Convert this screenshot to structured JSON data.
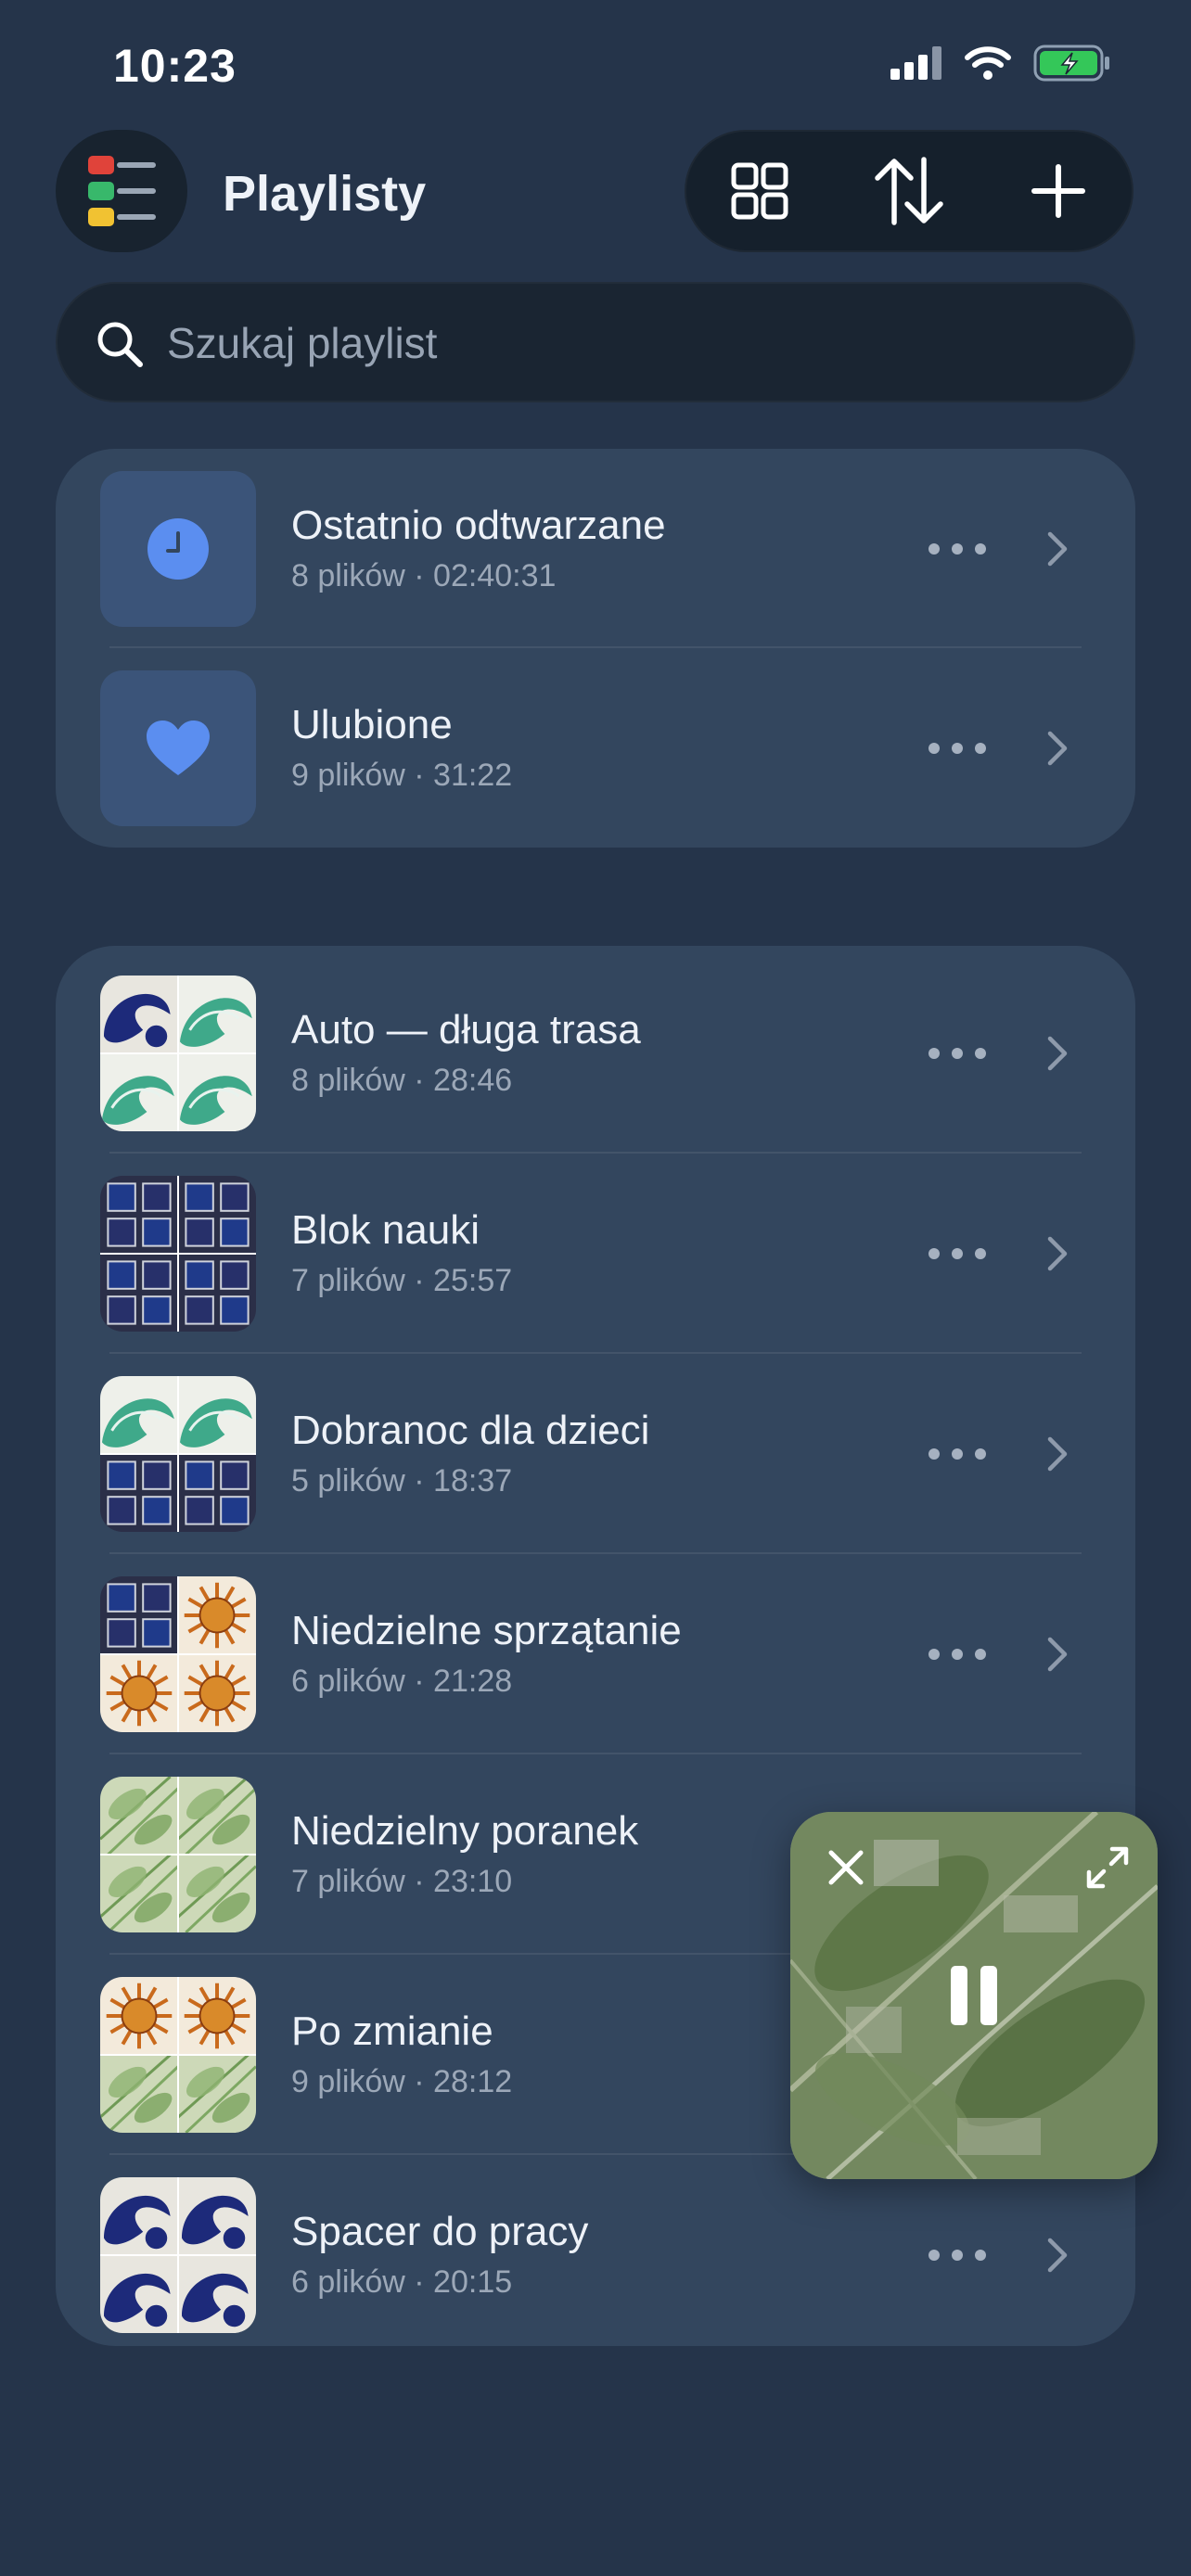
{
  "status_bar": {
    "time": "10:23",
    "signal_icon": "signal-bars-icon",
    "wifi_icon": "wifi-icon",
    "battery_icon": "battery-charging-icon",
    "battery_color": "#34c759"
  },
  "header": {
    "title": "Playlisty",
    "app_icon": "playlist-stack-icon",
    "toolbar": [
      {
        "name": "grid-view-button",
        "icon": "grid-icon"
      },
      {
        "name": "sort-button",
        "icon": "sort-arrows-icon"
      },
      {
        "name": "add-playlist-button",
        "icon": "plus-icon"
      }
    ]
  },
  "search": {
    "placeholder": "Szukaj playlist",
    "value": ""
  },
  "special_playlists": [
    {
      "title": "Ostatnio odtwarzane",
      "subtitle": "8 plików · 02:40:31",
      "icon": "clock-icon"
    },
    {
      "title": "Ulubione",
      "subtitle": "9 plików · 31:22",
      "icon": "heart-icon"
    }
  ],
  "playlists": [
    {
      "title": "Auto — długa trasa",
      "subtitle": "8 plików · 28:46",
      "cover": [
        "waves-blue",
        "waves-green",
        "waves-green",
        "waves-green"
      ]
    },
    {
      "title": "Blok nauki",
      "subtitle": "7 plików · 25:57",
      "cover": [
        "windows",
        "windows",
        "windows",
        "windows"
      ]
    },
    {
      "title": "Dobranoc dla dzieci",
      "subtitle": "5 plików · 18:37",
      "cover": [
        "waves-green",
        "waves-green",
        "windows",
        "windows"
      ]
    },
    {
      "title": "Niedzielne sprzątanie",
      "subtitle": "6 plików · 21:28",
      "cover": [
        "windows",
        "sun",
        "sun",
        "sun"
      ]
    },
    {
      "title": "Niedzielny poranek",
      "subtitle": "7 plików · 23:10",
      "cover": [
        "leaves",
        "leaves",
        "leaves",
        "leaves"
      ]
    },
    {
      "title": "Po zmianie",
      "subtitle": "9 plików · 28:12",
      "cover": [
        "sun",
        "sun",
        "leaves",
        "leaves"
      ]
    },
    {
      "title": "Spacer do pracy",
      "subtitle": "6 plików · 20:15",
      "cover": [
        "waves-blue",
        "waves-blue",
        "waves-blue",
        "waves-blue"
      ]
    }
  ],
  "mini_player": {
    "close_icon": "close-icon",
    "expand_icon": "expand-icon",
    "pause_icon": "pause-icon",
    "artwork": "leaves"
  },
  "colors": {
    "background": "#25344a",
    "card": "#33465e",
    "accent": "#5b8ef0"
  }
}
